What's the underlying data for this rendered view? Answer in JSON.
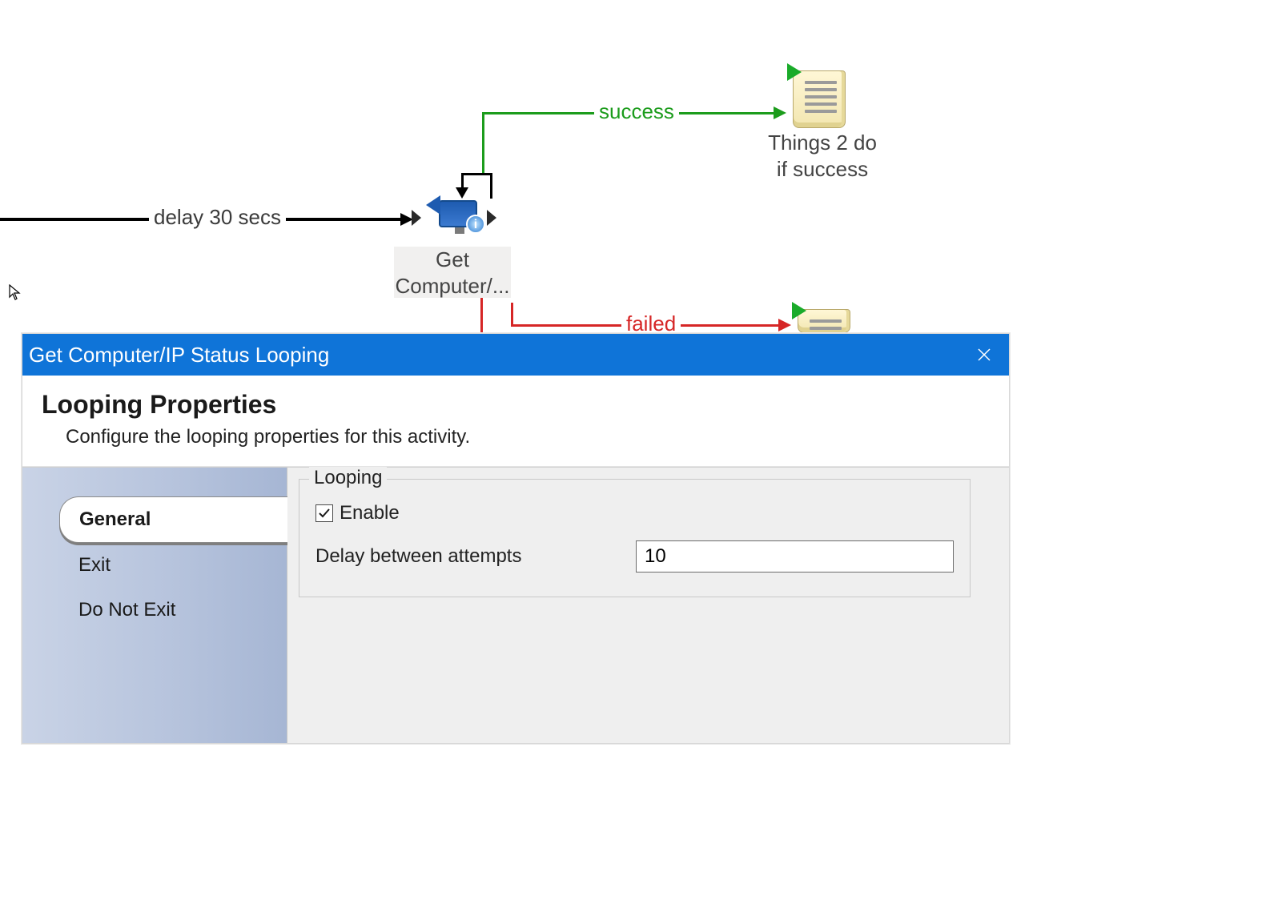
{
  "flow": {
    "delay_label": "delay 30 secs",
    "success_label": "success",
    "failed_label": "failed",
    "node_get_computer": "Get\nComputer/...",
    "node_success": "Things 2 do\nif success"
  },
  "dialog": {
    "title": "Get Computer/IP Status Looping",
    "heading": "Looping Properties",
    "subtitle": "Configure the looping properties for this activity.",
    "nav": {
      "general": "General",
      "exit": "Exit",
      "do_not_exit": "Do Not Exit"
    },
    "fieldset_legend": "Looping",
    "enable_label": "Enable",
    "enable_checked": true,
    "delay_label": "Delay between attempts",
    "delay_value": "10"
  }
}
